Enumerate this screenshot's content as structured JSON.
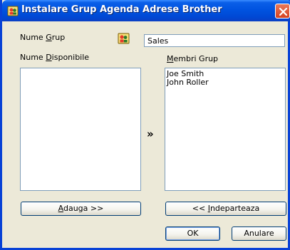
{
  "window": {
    "title": "Instalare Grup Agenda Adrese Brother",
    "title_icon": "address-book-people-icon",
    "close_icon": "close-x-icon"
  },
  "group_name": {
    "label_pre": "Nume ",
    "label_u": "G",
    "label_post": "rup",
    "icon": "group-people-icon",
    "value": "Sales"
  },
  "available": {
    "label_pre": "Nume ",
    "label_u": "D",
    "label_post": "isponibile",
    "items": []
  },
  "members": {
    "label_pre": "",
    "label_u": "M",
    "label_post": "embri Grup",
    "items": [
      "Joe Smith",
      "John Roller"
    ]
  },
  "transfer_arrow": "»",
  "buttons": {
    "add_u": "A",
    "add_post": "dauga >>",
    "remove_pre": "<< ",
    "remove_u": "I",
    "remove_post": "ndeparteaza",
    "ok": "OK",
    "cancel": "Anulare"
  },
  "colors": {
    "title_bar": "#0053e0",
    "dialog_bg": "#ece9d8",
    "field_border": "#7f9db9",
    "close_button": "#d6411e"
  }
}
